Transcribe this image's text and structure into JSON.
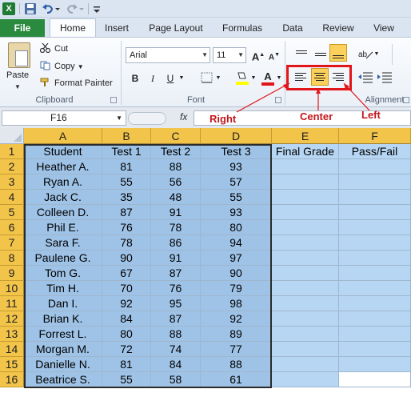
{
  "titlebar": {
    "app_icon": "X",
    "icons": [
      "save-icon",
      "undo-icon",
      "redo-icon",
      "customize-qat-icon"
    ]
  },
  "tabs": {
    "file": "File",
    "items": [
      "Home",
      "Insert",
      "Page Layout",
      "Formulas",
      "Data",
      "Review",
      "View"
    ]
  },
  "ribbon": {
    "clipboard": {
      "paste": "Paste",
      "cut": "Cut",
      "copy": "Copy",
      "format_painter": "Format Painter",
      "label": "Clipboard"
    },
    "font": {
      "name": "Arial",
      "size": "11",
      "bold": "B",
      "italic": "I",
      "underline": "U",
      "font_color_letter": "A",
      "grow": "A",
      "shrink": "A",
      "label": "Font"
    },
    "alignment": {
      "label": "Alignment"
    },
    "colors": {
      "highlight": "#e0161b",
      "fill_swatch": "#ffff00",
      "font_swatch": "#e0161b",
      "active_button": "#fbd15b"
    }
  },
  "formula_bar": {
    "name_box": "F16",
    "fx": "fx",
    "content": ""
  },
  "annotations": {
    "right": "Right",
    "center": "Center",
    "left": "Left"
  },
  "sheet": {
    "columns": [
      "A",
      "B",
      "C",
      "D",
      "E",
      "F"
    ],
    "rows": [
      "1",
      "2",
      "3",
      "4",
      "5",
      "6",
      "7",
      "8",
      "9",
      "10",
      "11",
      "12",
      "13",
      "14",
      "15",
      "16"
    ],
    "header": [
      "Student",
      "Test 1",
      "Test 2",
      "Test 3",
      "Final Grade",
      "Pass/Fail"
    ],
    "data": [
      [
        "Heather A.",
        "81",
        "88",
        "93"
      ],
      [
        "Ryan A.",
        "55",
        "56",
        "57"
      ],
      [
        "Jack C.",
        "35",
        "48",
        "55"
      ],
      [
        "Colleen D.",
        "87",
        "91",
        "93"
      ],
      [
        "Phil E.",
        "76",
        "78",
        "80"
      ],
      [
        "Sara F.",
        "78",
        "86",
        "94"
      ],
      [
        "Paulene G.",
        "90",
        "91",
        "97"
      ],
      [
        "Tom G.",
        "67",
        "87",
        "90"
      ],
      [
        "Tim H.",
        "70",
        "76",
        "79"
      ],
      [
        "Dan I.",
        "92",
        "95",
        "98"
      ],
      [
        "Brian K.",
        "84",
        "87",
        "92"
      ],
      [
        "Forrest L.",
        "80",
        "88",
        "89"
      ],
      [
        "Morgan M.",
        "72",
        "74",
        "77"
      ],
      [
        "Danielle N.",
        "81",
        "84",
        "88"
      ],
      [
        "Beatrice S.",
        "55",
        "58",
        "61"
      ]
    ],
    "colors": {
      "selection_fill": "#b7d6f3",
      "selection_fill_dark": "#9fc3e7",
      "header_highlight": "#f3c44a",
      "active_cell": "#ffffff"
    }
  }
}
